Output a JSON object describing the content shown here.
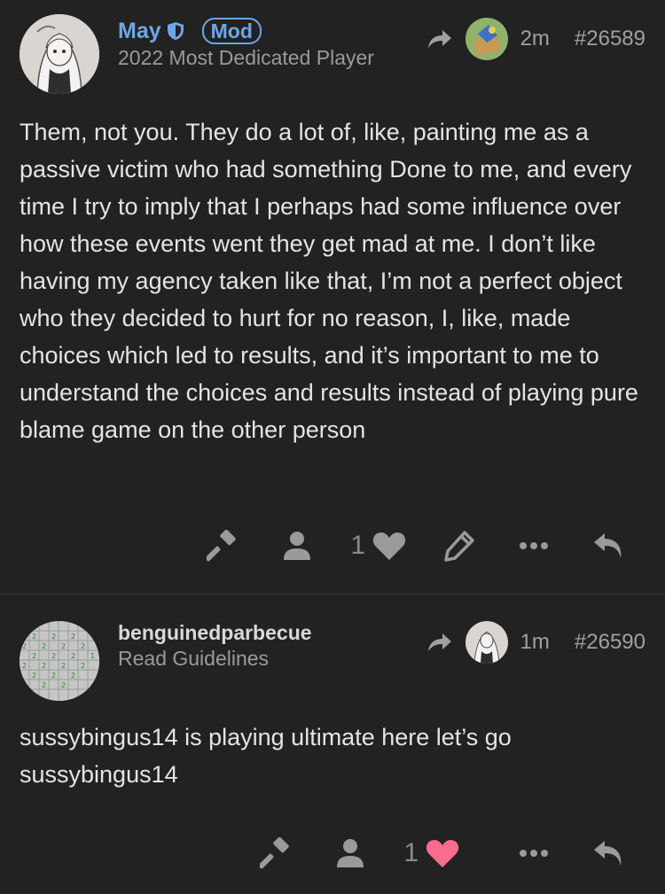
{
  "posts": [
    {
      "username": "May",
      "badge": "Mod",
      "user_title": "2022 Most Dedicated Player",
      "time": "2m",
      "post_number": "#26589",
      "text": "Them, not you. They do a lot of, like, painting me as a passive victim who had something Done to me, and every time I try to imply that I perhaps had some influence over how these events went they get mad at me. I don’t like having my agency taken like that, I’m not a perfect object who they decided to hurt for no reason, I, like, made choices which led to results, and it’s important to me to understand the choices and results instead of playing pure blame game on the other person",
      "like_count": "1",
      "liked": false
    },
    {
      "username": "benguinedparbecue",
      "user_title": "Read Guidelines",
      "time": "1m",
      "post_number": "#26590",
      "text": "sussybingus14 is playing ultimate here let’s go sussybingus14",
      "like_count": "1",
      "liked": true
    }
  ],
  "colors": {
    "background": "#222222",
    "mod_blue": "#6ea6e6",
    "icon_grey": "#9a9a9a",
    "liked_heart": "#fa6c8d"
  },
  "icons": [
    "shield-icon",
    "reply-to-icon",
    "hammer-icon",
    "user-icon",
    "heart-icon",
    "pencil-icon",
    "more-icon",
    "reply-icon"
  ]
}
